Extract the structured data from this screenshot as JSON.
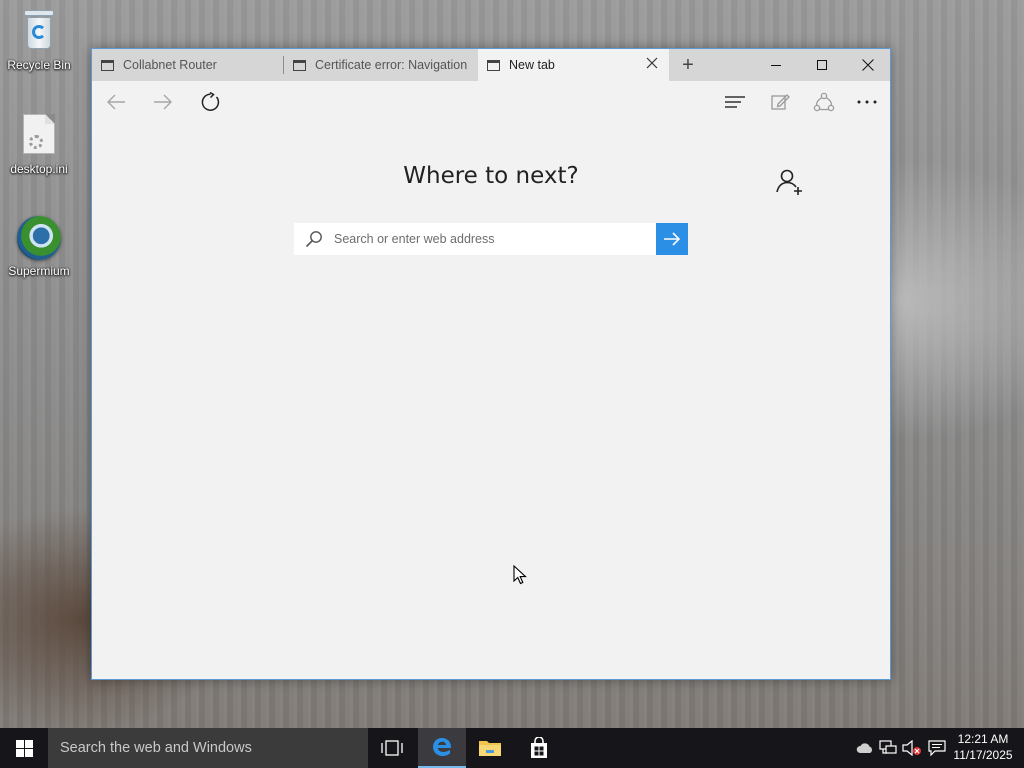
{
  "desktop": {
    "icons": [
      {
        "label": "Recycle Bin",
        "icon": "recycle-bin-icon"
      },
      {
        "label": "desktop.ini",
        "icon": "ini-file-icon"
      },
      {
        "label": "Supermium",
        "icon": "supermium-browser-icon"
      }
    ]
  },
  "browser": {
    "tabs": [
      {
        "title": "Collabnet Router",
        "active": false
      },
      {
        "title": "Certificate error: Navigation",
        "active": false
      },
      {
        "title": "New tab",
        "active": true
      }
    ],
    "new_tab_button": "+",
    "window_controls": [
      "minimize-icon",
      "maximize-icon",
      "close-icon"
    ],
    "toolbar": [
      "back-icon",
      "forward-icon",
      "refresh-icon",
      "hub-icon",
      "web-note-icon",
      "share-icon",
      "more-icon"
    ],
    "page": {
      "heading": "Where to next?",
      "search_placeholder": "Search or enter web address",
      "search_value": ""
    },
    "accent_color": "#2b8fe6"
  },
  "taskbar": {
    "search_placeholder": "Search the web and Windows",
    "apps": [
      "task-view-icon",
      "edge-icon",
      "file-explorer-icon",
      "store-icon"
    ],
    "tray": [
      "onedrive-icon",
      "network-icon",
      "volume-muted-icon",
      "action-center-icon"
    ],
    "time": "12:21 AM",
    "date": "11/17/2025"
  }
}
